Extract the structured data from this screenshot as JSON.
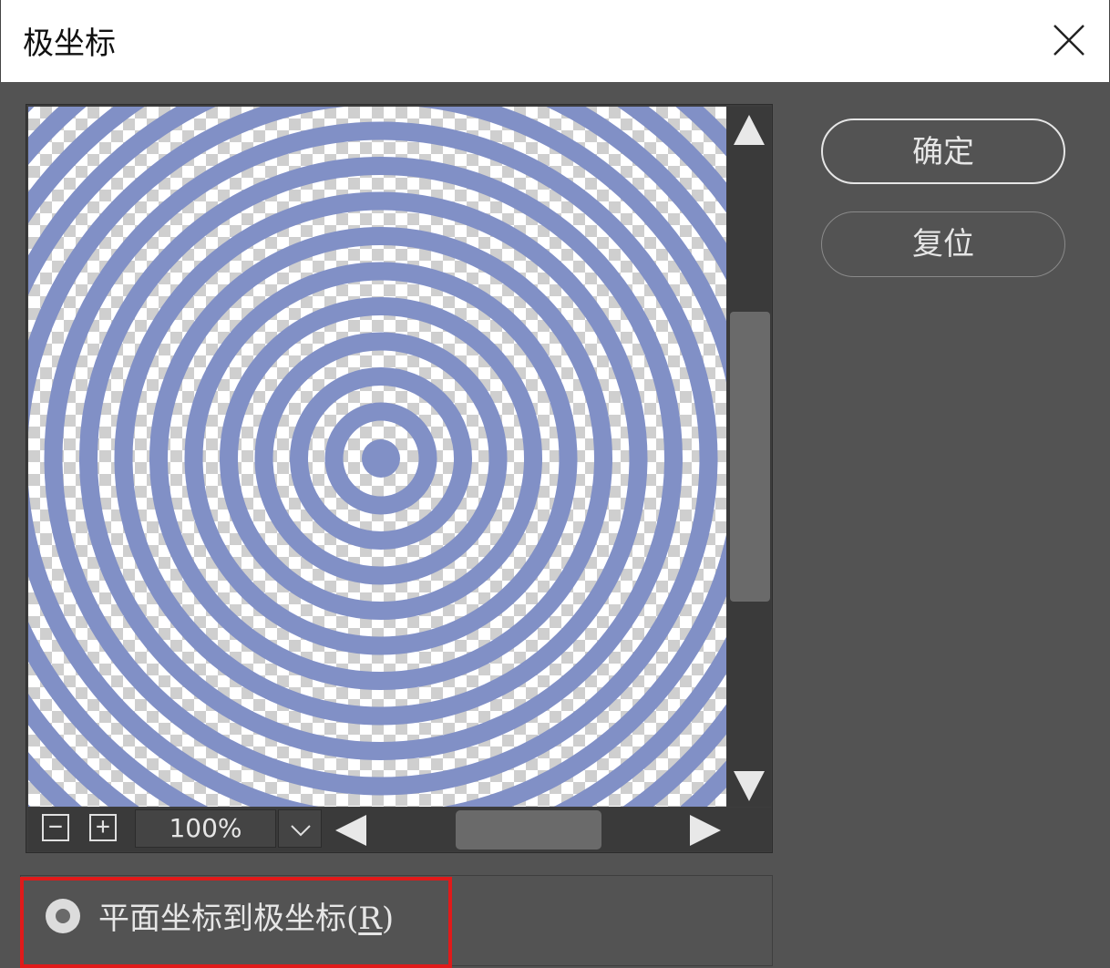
{
  "dialog": {
    "title": "极坐标",
    "close_icon": "close-icon"
  },
  "preview": {
    "zoom_value": "100%",
    "zoom_out_label": "−",
    "zoom_in_label": "+",
    "ring_color": "#8190c6",
    "checker_color": "#cfcfcf"
  },
  "buttons": {
    "ok_label": "确定",
    "reset_label": "复位"
  },
  "options": {
    "rect_to_polar_label": "平面坐标到极坐标(",
    "rect_to_polar_hotkey": "R",
    "rect_to_polar_suffix": ")",
    "rect_to_polar_selected": true
  },
  "colors": {
    "panel_bg": "#535353",
    "highlight_border": "#e01a1a"
  }
}
